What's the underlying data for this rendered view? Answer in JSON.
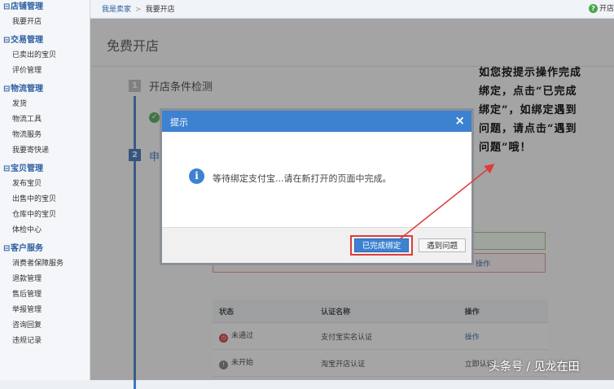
{
  "sidebar": {
    "groups": [
      {
        "title": "店铺管理",
        "items": [
          "我要开店"
        ]
      },
      {
        "title": "交易管理",
        "items": [
          "已卖出的宝贝",
          "评价管理"
        ]
      },
      {
        "title": "物流管理",
        "items": [
          "发货",
          "物流工具",
          "物流服务",
          "我要寄快递"
        ]
      },
      {
        "title": "宝贝管理",
        "items": [
          "发布宝贝",
          "出售中的宝贝",
          "仓库中的宝贝",
          "体检中心"
        ]
      },
      {
        "title": "客户服务",
        "items": [
          "消费者保障服务",
          "退款管理",
          "售后管理",
          "举报管理",
          "咨询回复",
          "违规记录"
        ]
      }
    ]
  },
  "topbar": {
    "crumb_root": "我是卖家",
    "crumb_sep": ">",
    "crumb_current": "我要开店",
    "help_label": "开店"
  },
  "main": {
    "page_title": "免费开店",
    "step1": {
      "num": "1",
      "title": "开店条件检测"
    },
    "step2": {
      "num": "2",
      "title": "申"
    },
    "red_box_link": "操作",
    "table": {
      "headers": [
        "状态",
        "认证名称",
        "操作"
      ],
      "rows": [
        {
          "status": "未通过",
          "name": "支付宝实名认证",
          "action": "操作"
        },
        {
          "status": "未开始",
          "name": "淘宝开店认证",
          "action": "立即认证"
        }
      ]
    }
  },
  "modal": {
    "title": "提示",
    "close": "×",
    "message": "等待绑定支付宝...请在新打开的页面中完成。",
    "primary_button": "已完成绑定",
    "secondary_button": "遇到问题"
  },
  "annotation": {
    "lines": [
      "如您按提示操作完成",
      "绑定，点击“已完成",
      "绑定”，如绑定遇到",
      "问题，请点击“遇到",
      "问题”哦！"
    ]
  },
  "watermark": "头条号 / 见龙在田",
  "colors": {
    "accent": "#3d82d0",
    "highlight_red": "#e03a3a",
    "link": "#2a5d9f"
  }
}
